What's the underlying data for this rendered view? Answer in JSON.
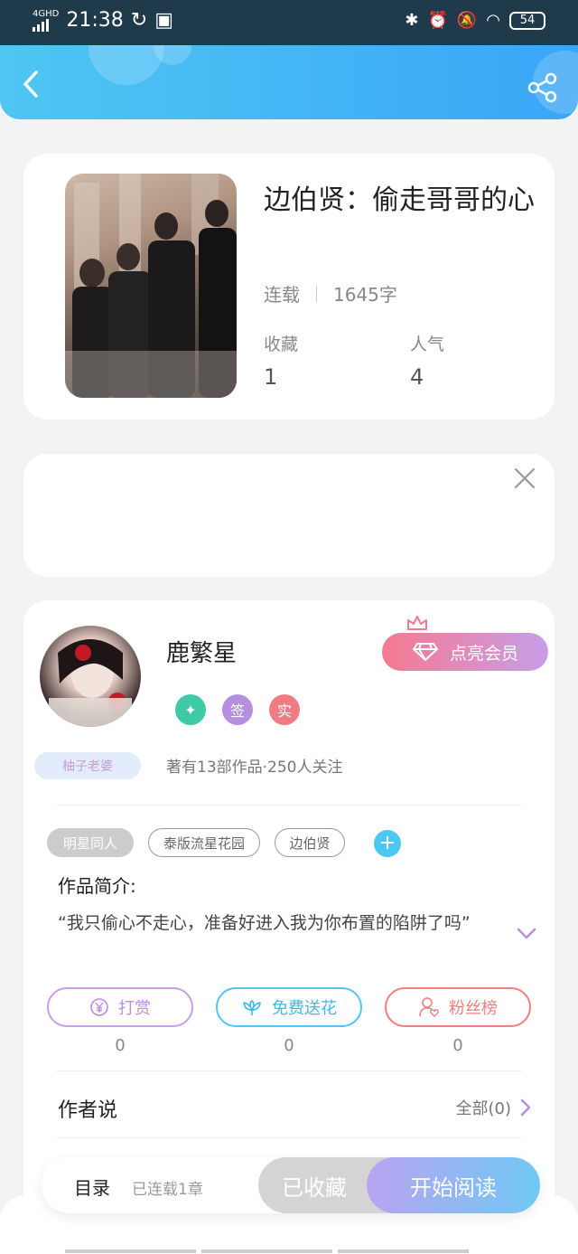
{
  "status_bar": {
    "network": "4GHD",
    "time": "21:38",
    "battery": "54"
  },
  "book": {
    "title": "边伯贤：偷走哥哥的心",
    "status": "连载",
    "word_count": "1645字",
    "favorites_label": "收藏",
    "favorites_value": "1",
    "popularity_label": "人气",
    "popularity_value": "4"
  },
  "author": {
    "name": "鹿繁星",
    "vip_button": "点亮会员",
    "badges": [
      "签",
      "实"
    ],
    "fan_tag": "柚子老婆",
    "stats": "著有13部作品·250人关注"
  },
  "tags": [
    "明星同人",
    "泰版流星花园",
    "边伯贤"
  ],
  "intro": {
    "label": "作品简介:",
    "text": "“我只偷心不走心，准备好进入我为你布置的陷阱了吗”"
  },
  "actions": [
    {
      "label": "打赏",
      "count": "0"
    },
    {
      "label": "免费送花",
      "count": "0"
    },
    {
      "label": "粉丝榜",
      "count": "0"
    }
  ],
  "author_say": {
    "label": "作者说",
    "all_link": "全部(0)"
  },
  "bottom_bar": {
    "toc": "目录",
    "chapters": "已连载1章",
    "collected": "已收藏",
    "start_reading": "开始阅读"
  },
  "colors": {
    "header_gradient": [
      "#4fc6f3",
      "#3aa6f7"
    ],
    "vip_gradient": [
      "#f67990",
      "#c79ee8"
    ],
    "read_gradient": [
      "#b8a4f0",
      "#6fc8f4"
    ],
    "tip_purple": "#c79ee8",
    "flower_cyan": "#4cc8f1",
    "fans_red": "#ef7f7f"
  }
}
